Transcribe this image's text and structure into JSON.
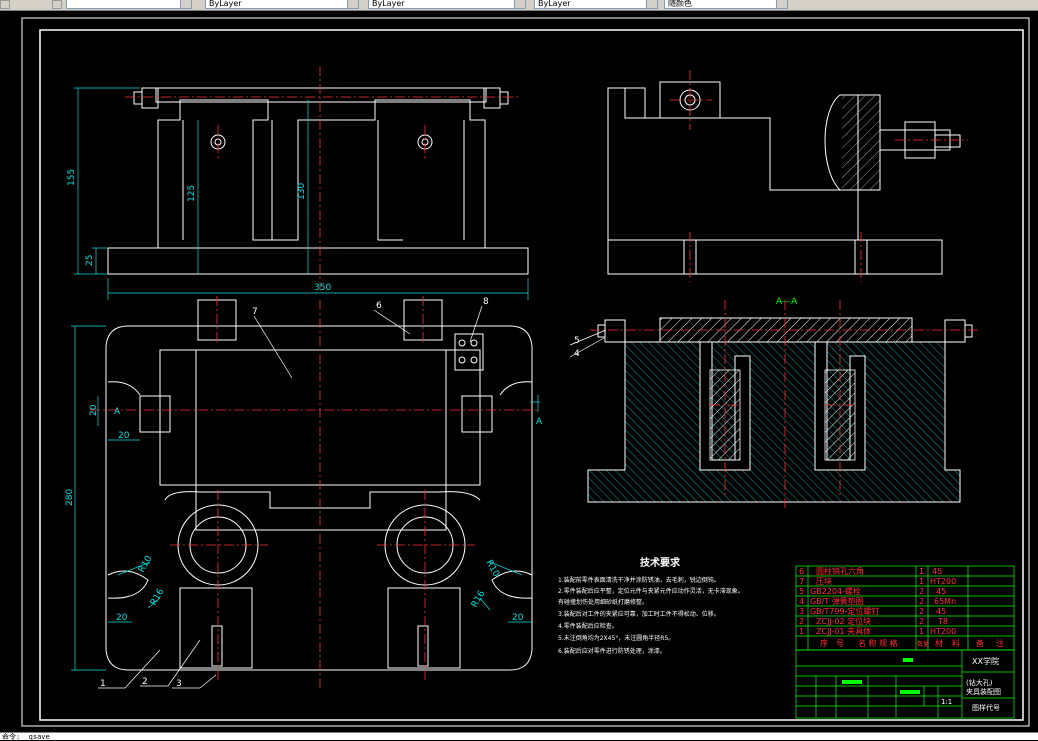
{
  "toolbar": {
    "layer_selector": "",
    "linetype_selector": "ByLayer",
    "lineweight_selector": "ByLayer",
    "color_selector": "ByLayer",
    "plotstyle_selector": "随颜色"
  },
  "drawing": {
    "dimensions": {
      "d155": "155",
      "d125": "125",
      "d130": "130",
      "d25": "25",
      "d350": "350",
      "d280": "280",
      "d20a": "20",
      "d20b": "20",
      "d20c": "20",
      "d20d": "20",
      "r10a": "R10",
      "r16a": "R16",
      "r10b": "R10",
      "r16b": "R16"
    },
    "section_marks": {
      "section_title": "A—A",
      "left_mark": "A",
      "right_mark": "A"
    },
    "balloons": [
      "1",
      "2",
      "3",
      "4",
      "5",
      "6",
      "7",
      "8"
    ],
    "tech_req": {
      "title": "技术要求",
      "items": [
        "1.装配前零件表面清洗干净并涂防锈油，去毛刺，锐边倒钝。",
        "2.零件装配后应平整，定位元件与夹紧元件应动作灵活，无卡滞现象。",
        "有碰撞划伤处用细砂纸打磨修整。",
        "3.装配后对工件的夹紧应可靠，加工时工件不得松动、位移。",
        "4.零件装配后应检查。",
        "5.未注倒角均为2X45°，未注圆角半径R5。",
        "6.装配后应对零件进行防锈处理，涂漆。"
      ]
    },
    "bom": {
      "rows": [
        {
          "no": "6",
          "name": "圆柱销孔六角",
          "qty": "1",
          "mat": "45"
        },
        {
          "no": "7",
          "name": "压块",
          "qty": "1",
          "mat": "HT200"
        },
        {
          "no": "5",
          "name": "GB2204-螺栓",
          "qty": "2",
          "mat": "45"
        },
        {
          "no": "4",
          "name": "GB/T 弹簧垫圈",
          "qty": "2",
          "mat": "65Mn"
        },
        {
          "no": "3",
          "name": "GB/T799-定位螺钉",
          "qty": "2",
          "mat": "45"
        },
        {
          "no": "2",
          "name": "ZCJJ-02 定位块",
          "qty": "2",
          "mat": "T8"
        },
        {
          "no": "1",
          "name": "ZCJJ-01 夹具体",
          "qty": "1",
          "mat": "HT200"
        }
      ],
      "header": [
        "序",
        "号",
        "名 称 规 格",
        "数量",
        "材",
        "料",
        "备",
        "注"
      ]
    },
    "title_block": {
      "company": "XX学院",
      "drawing_name": "(钻大孔)",
      "drawing_name2": "夹具装配图",
      "scale": "1:1",
      "drawing_no": "图样代号"
    }
  },
  "cmdline": {
    "text": "命令: _qsave"
  }
}
